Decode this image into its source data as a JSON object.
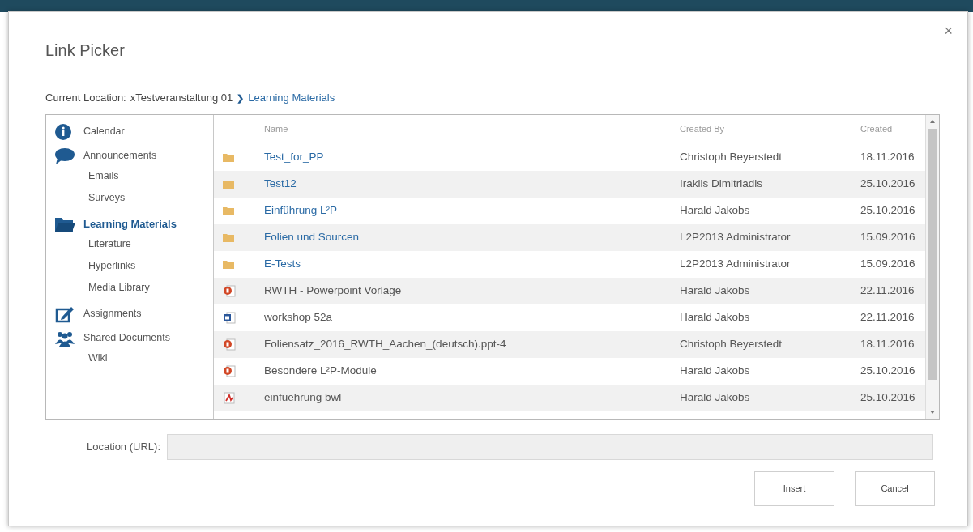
{
  "dialog": {
    "title": "Link Picker",
    "close": "×"
  },
  "breadcrumb": {
    "label": "Current Location:",
    "parent": "xTestveranstaltung 01",
    "separator": "❯",
    "current": "Learning Materials"
  },
  "sidebar": [
    {
      "label": "Calendar",
      "selected": false
    },
    {
      "label": "Announcements",
      "selected": false,
      "children": [
        {
          "label": "Emails"
        },
        {
          "label": "Surveys"
        }
      ]
    },
    {
      "label": "Learning Materials",
      "selected": true,
      "children": [
        {
          "label": "Literature"
        },
        {
          "label": "Hyperlinks"
        },
        {
          "label": "Media Library"
        }
      ]
    },
    {
      "label": "Assignments",
      "selected": false
    },
    {
      "label": "Shared Documents",
      "selected": false,
      "children": [
        {
          "label": "Wiki"
        }
      ]
    }
  ],
  "table": {
    "columns": [
      "Name",
      "Created By",
      "Created"
    ],
    "rows": [
      {
        "kind": "folder",
        "name": "Test_for_PP",
        "created_by": "Christoph Beyerstedt",
        "created": "18.11.2016"
      },
      {
        "kind": "folder",
        "name": "Test12",
        "created_by": "Iraklis Dimitriadis",
        "created": "25.10.2016"
      },
      {
        "kind": "folder",
        "name": "Einführung L²P",
        "created_by": "Harald Jakobs",
        "created": "25.10.2016"
      },
      {
        "kind": "folder",
        "name": "Folien und Sourcen",
        "created_by": "L2P2013 Administrator",
        "created": "15.09.2016"
      },
      {
        "kind": "folder",
        "name": "E-Tests",
        "created_by": "L2P2013 Administrator",
        "created": "15.09.2016"
      },
      {
        "kind": "presentation",
        "name": "RWTH - Powerpoint Vorlage",
        "created_by": "Harald Jakobs",
        "created": "22.11.2016"
      },
      {
        "kind": "document",
        "name": "workshop 52a",
        "created_by": "Harald Jakobs",
        "created": "22.11.2016"
      },
      {
        "kind": "presentation",
        "name": "Foliensatz_2016_RWTH_Aachen_(deutsch).ppt-4",
        "created_by": "Christoph Beyerstedt",
        "created": "18.11.2016"
      },
      {
        "kind": "presentation",
        "name": "Besondere L²P-Module",
        "created_by": "Harald Jakobs",
        "created": "25.10.2016"
      },
      {
        "kind": "pdf",
        "name": "einfuehrung bwl",
        "created_by": "Harald Jakobs",
        "created": "25.10.2016"
      }
    ]
  },
  "location": {
    "label": "Location (URL):",
    "disabled": true
  },
  "buttons": [
    "Insert",
    "Cancel"
  ]
}
